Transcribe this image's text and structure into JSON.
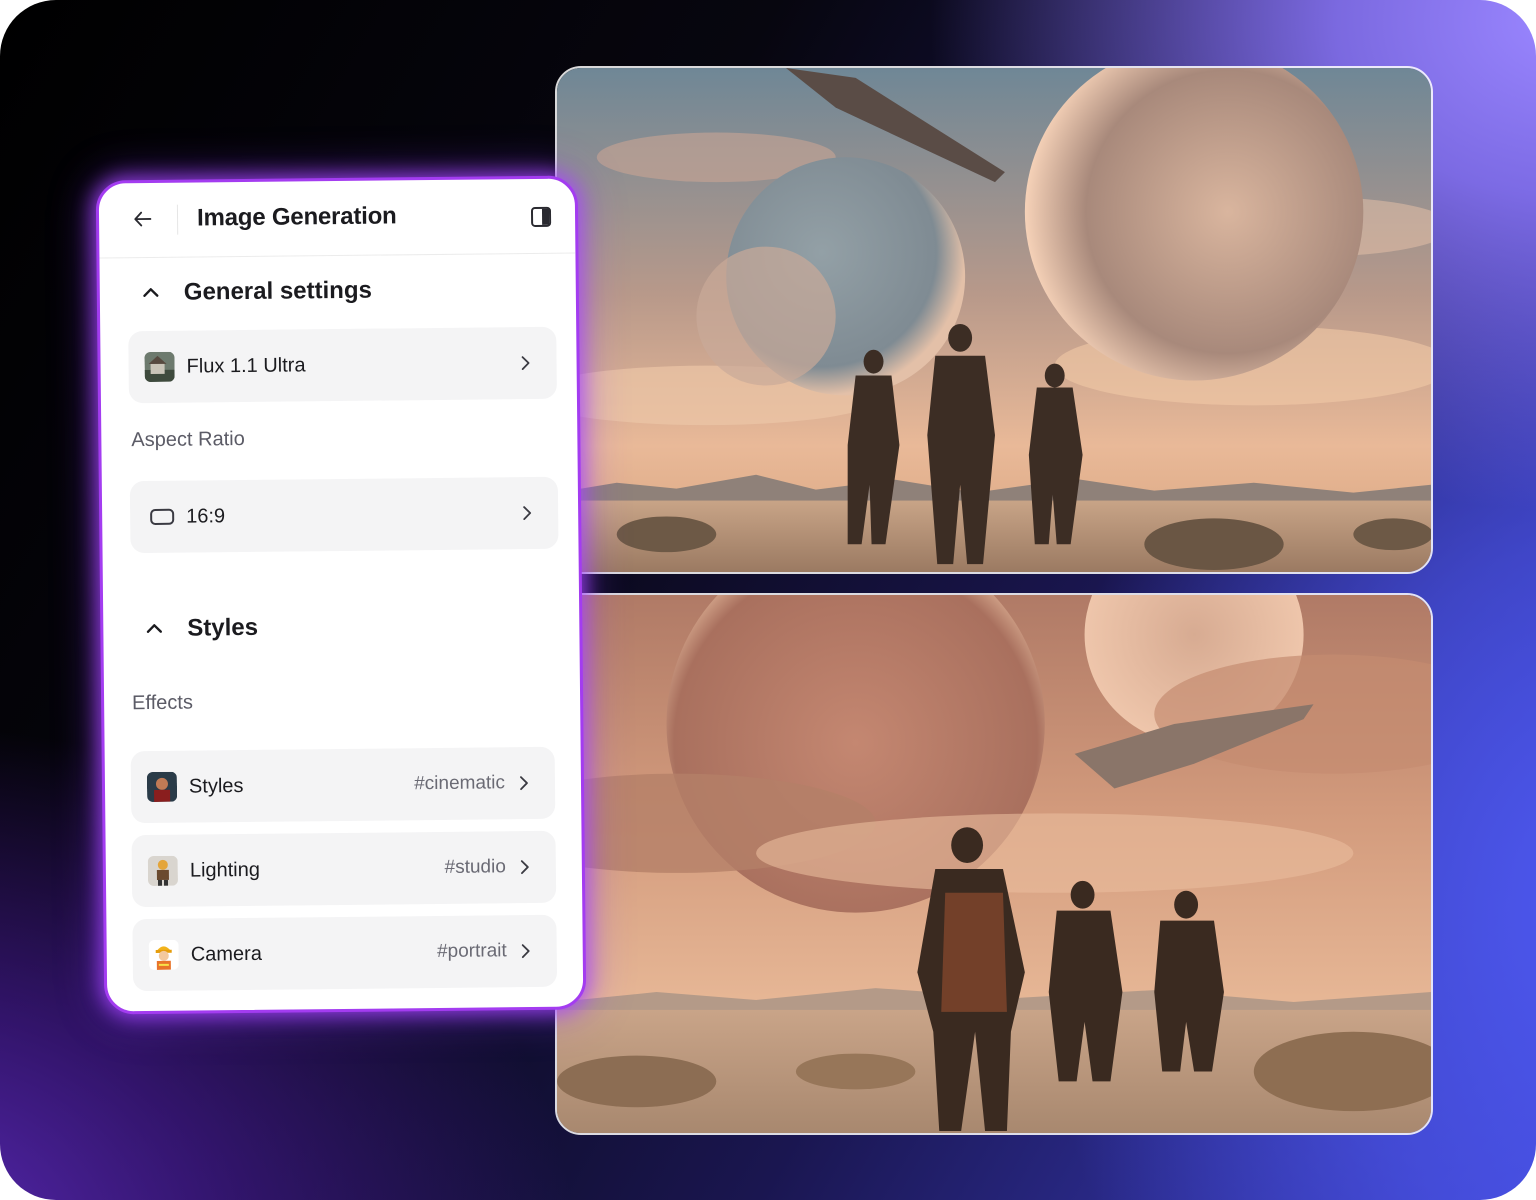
{
  "panel": {
    "title": "Image Generation",
    "general_settings": {
      "heading": "General settings",
      "model": "Flux 1.1 Ultra",
      "aspect_ratio_label": "Aspect Ratio",
      "aspect_ratio_value": "16:9"
    },
    "styles": {
      "heading": "Styles",
      "effects_label": "Effects",
      "items": [
        {
          "label": "Styles",
          "value": "#cinematic"
        },
        {
          "label": "Lighting",
          "value": "#studio"
        },
        {
          "label": "Camera",
          "value": "#portrait"
        }
      ]
    }
  },
  "icons": {
    "back": "arrow-left-icon",
    "sidebar": "sidebar-toggle-icon",
    "collapse": "chevron-up-icon",
    "row_arrow": "chevron-right-icon",
    "aspect": "rectangle-ratio-icon"
  },
  "colors": {
    "panel_glow": "#a33cf0",
    "row_bg": "#f4f4f5",
    "text_primary": "#1b1b1f",
    "text_secondary": "#6a6a74"
  }
}
